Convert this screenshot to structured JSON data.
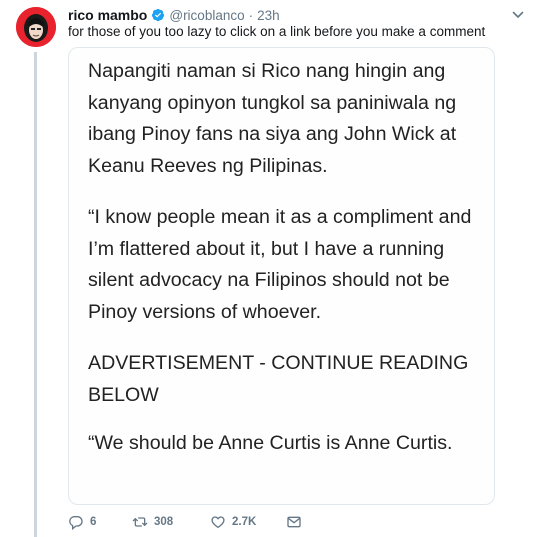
{
  "tweet": {
    "author_name": "rico mambo",
    "handle": "@ricoblanco",
    "separator": "·",
    "time": "23h",
    "text": "for those of you too lazy to click on a link before you make a comment",
    "verified_icon": "verified-badge-icon",
    "menu_icon": "chevron-down-icon"
  },
  "image": {
    "paragraphs": [
      "Napangiti naman si Rico nang hingin ang kanyang opinyon tungkol sa paniniwala ng ibang Pinoy fans na siya ang John Wick at Keanu Reeves ng Pilipinas.",
      "“I know people mean it as a compliment and I’m flattered about it, but I have a running silent advocacy na Filipinos should not be Pinoy versions of whoever.",
      "ADVERTISEMENT - CONTINUE READING BELOW",
      "“We should be Anne Curtis is Anne Curtis."
    ]
  },
  "actions": {
    "reply_count": "6",
    "retweet_count": "308",
    "like_count": "2.7K"
  },
  "colors": {
    "text": "#14171a",
    "secondary": "#657786",
    "verified": "#1da1f2",
    "thread_line": "#ccd6dd",
    "avatar_bg": "#e8232d"
  }
}
